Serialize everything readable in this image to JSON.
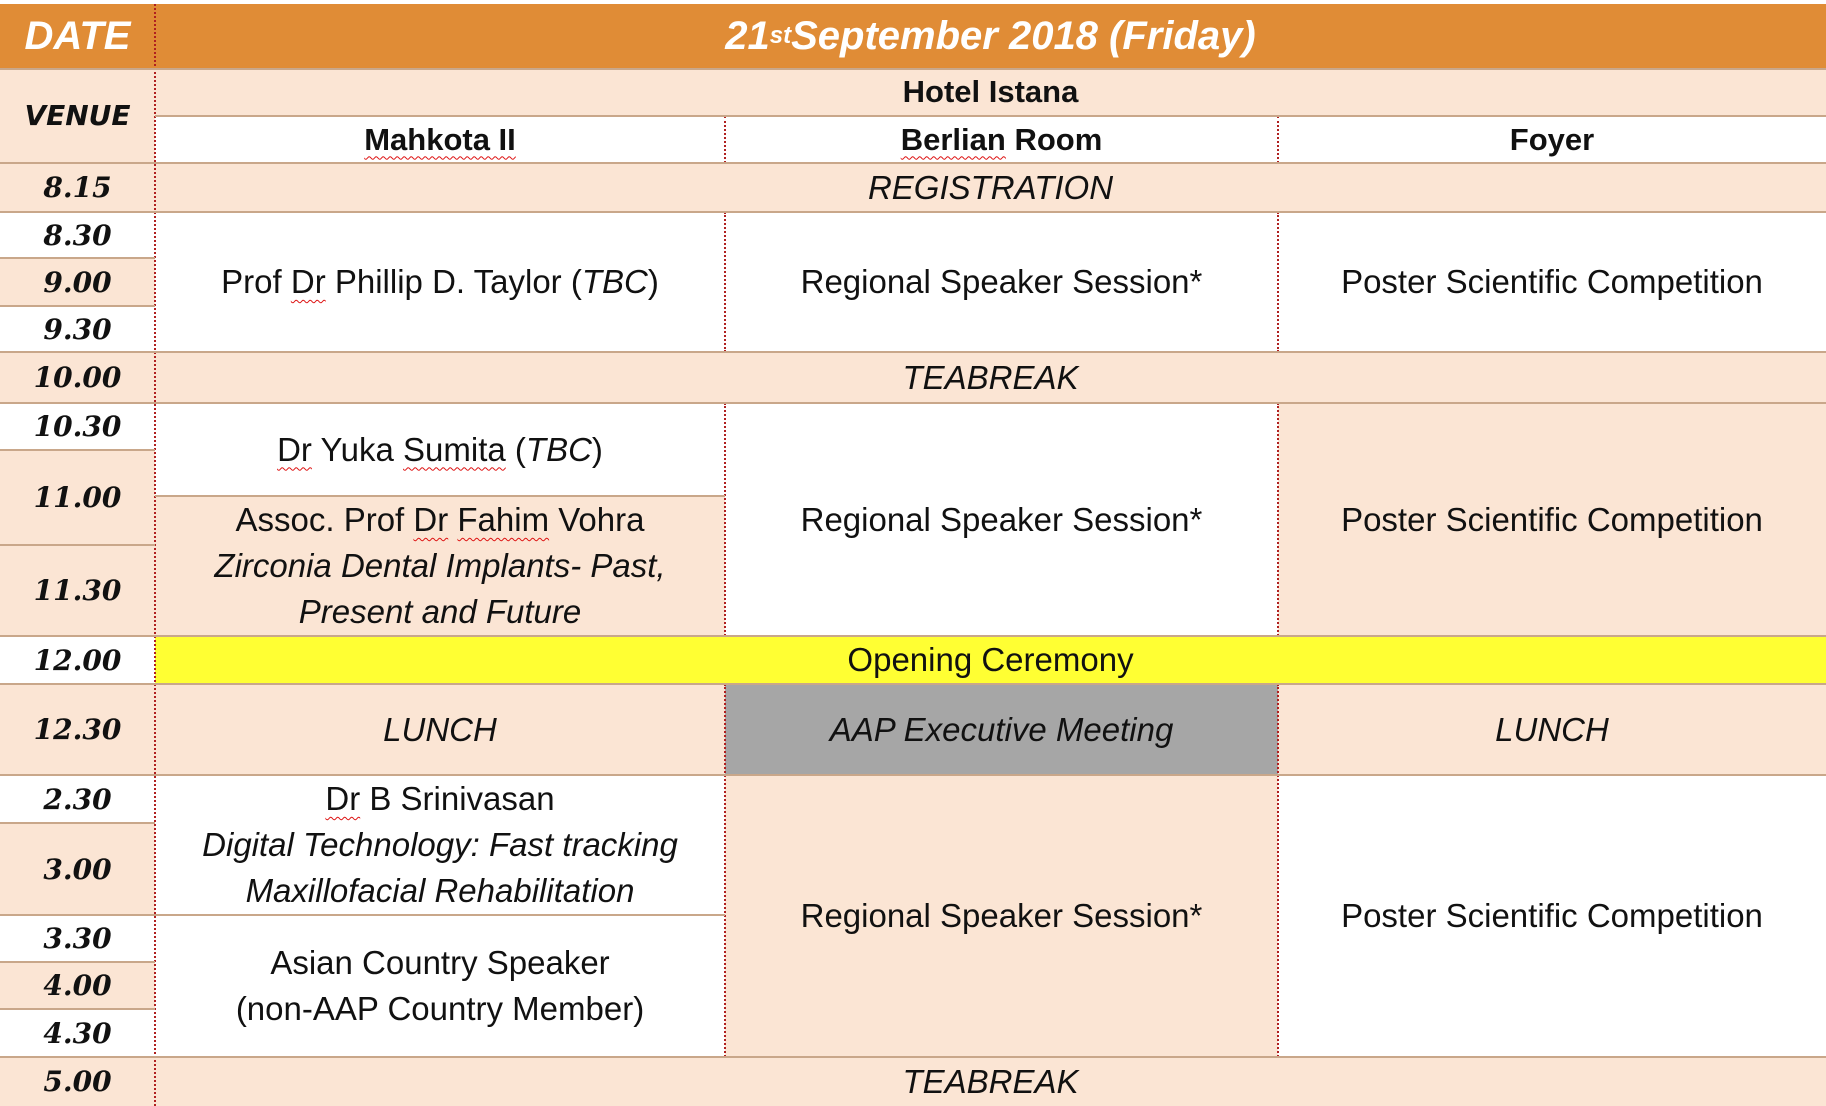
{
  "header": {
    "date_label": "DATE",
    "date_main": "21",
    "date_sup": "st",
    "date_rest": " September 2018 (Friday)"
  },
  "venue": {
    "label": "VENUE",
    "hotel": "Hotel Istana"
  },
  "rooms": {
    "room1": "Mahkota II",
    "room2_word": "Berlian",
    "room2_rest": " Room",
    "room3": "Foyer"
  },
  "times": [
    "8.15",
    "8.30",
    "9.00",
    "9.30",
    "10.00",
    "10.30",
    "11.00",
    "11.30",
    "12.00",
    "12.30",
    "2.30",
    "3.00",
    "3.30",
    "4.00",
    "4.30",
    "5.00"
  ],
  "sessions": {
    "registration": "REGISTRATION",
    "taylor": {
      "pre": "Prof ",
      "dr": "Dr",
      "name": " Phillip D. Taylor (",
      "tbc": "TBC",
      "close": ")"
    },
    "regional": "Regional Speaker Session*",
    "poster": "Poster Scientific Competition",
    "teabreak": "TEABREAK",
    "sumita": {
      "dr": "Dr",
      "mid": " Yuka ",
      "surname": "Sumita",
      "open": " (",
      "tbc": "TBC",
      "close": ")"
    },
    "vohra": {
      "pre": "Assoc. Prof ",
      "dr": "Dr",
      "sp": " ",
      "fahim": "Fahim",
      "rest": " Vohra",
      "line2": "Zirconia Dental Implants- Past,",
      "line3": "Present and Future"
    },
    "opening": "Opening Ceremony",
    "lunch": "LUNCH",
    "aap_meeting": "AAP Executive Meeting",
    "srinivasan": {
      "dr": "Dr",
      "name": " B Srinivasan",
      "line2": "Digital Technology: Fast tracking",
      "line3": "Maxillofacial Rehabilitation"
    },
    "asian": {
      "line1": "Asian Country Speaker",
      "line2": "(non-AAP Country Member)"
    }
  }
}
